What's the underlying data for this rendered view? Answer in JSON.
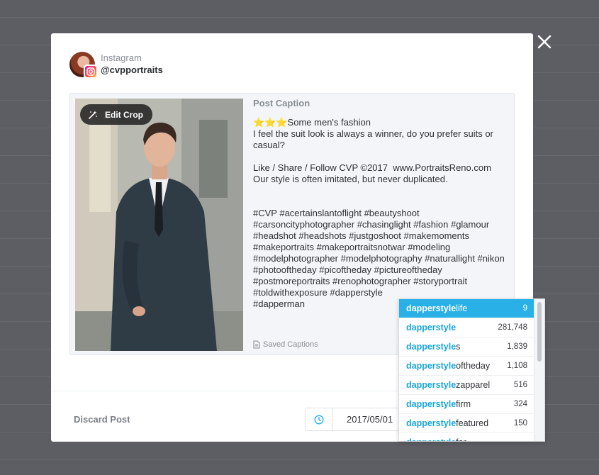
{
  "account": {
    "platform": "Instagram",
    "handle": "@cvpportraits",
    "avatar_icon": "profile-photo",
    "badge_icon": "instagram-icon"
  },
  "image_panel": {
    "edit_crop_label": "Edit Crop",
    "edit_crop_icon": "magic-wand-icon",
    "photo_subject": "portrait-photo"
  },
  "caption": {
    "title": "Post Caption",
    "text": "⭐⭐⭐Some men's fashion\nI feel the suit look is always a winner, do you prefer suits or casual?\n\nLike / Share / Follow CVP ©2017  www.PortraitsReno.com\nOur style is often imitated, but never duplicated.\n\n\n#CVP #acertainslantoflight #beautyshoot #carsoncityphotographer #chasinglight #fashion #glamour #headshot #headshots #justgoshoot #makemoments #makeportraits #makeportraitsnotwar #modeling #modelphotographer #modelphotography #naturallight #nikon #photooftheday #picoftheday #pictureoftheday #postmoreportraits #renophotographer #storyportrait #toldwithexposure #dapperstyle\n#dapperman",
    "saved_captions_label": "Saved Captions",
    "saved_captions_icon": "document-icon"
  },
  "hashtag_suggestions": {
    "query": "dapperstyle",
    "items": [
      {
        "match": "dapperstyle",
        "rest": "life",
        "count": "9",
        "active": true
      },
      {
        "match": "dapperstyle",
        "rest": "",
        "count": "281,748",
        "active": false
      },
      {
        "match": "dapperstyle",
        "rest": "s",
        "count": "1,839",
        "active": false
      },
      {
        "match": "dapperstyle",
        "rest": "oftheday",
        "count": "1,108",
        "active": false
      },
      {
        "match": "dapperstyle",
        "rest": "zapparel",
        "count": "516",
        "active": false
      },
      {
        "match": "dapperstyle",
        "rest": "firm",
        "count": "324",
        "active": false
      },
      {
        "match": "dapperstyle",
        "rest": "featured",
        "count": "150",
        "active": false
      },
      {
        "match": "dapperstyle",
        "rest": "for",
        "count": "",
        "active": false
      }
    ]
  },
  "footer": {
    "discard_label": "Discard Post",
    "schedule_icon": "clock-icon",
    "date_value": "2017/05/01"
  },
  "window": {
    "close_icon": "close-icon"
  },
  "colors": {
    "accent": "#29b0e6",
    "match_text": "#1aa6dc",
    "backdrop": "#5c5e64"
  }
}
